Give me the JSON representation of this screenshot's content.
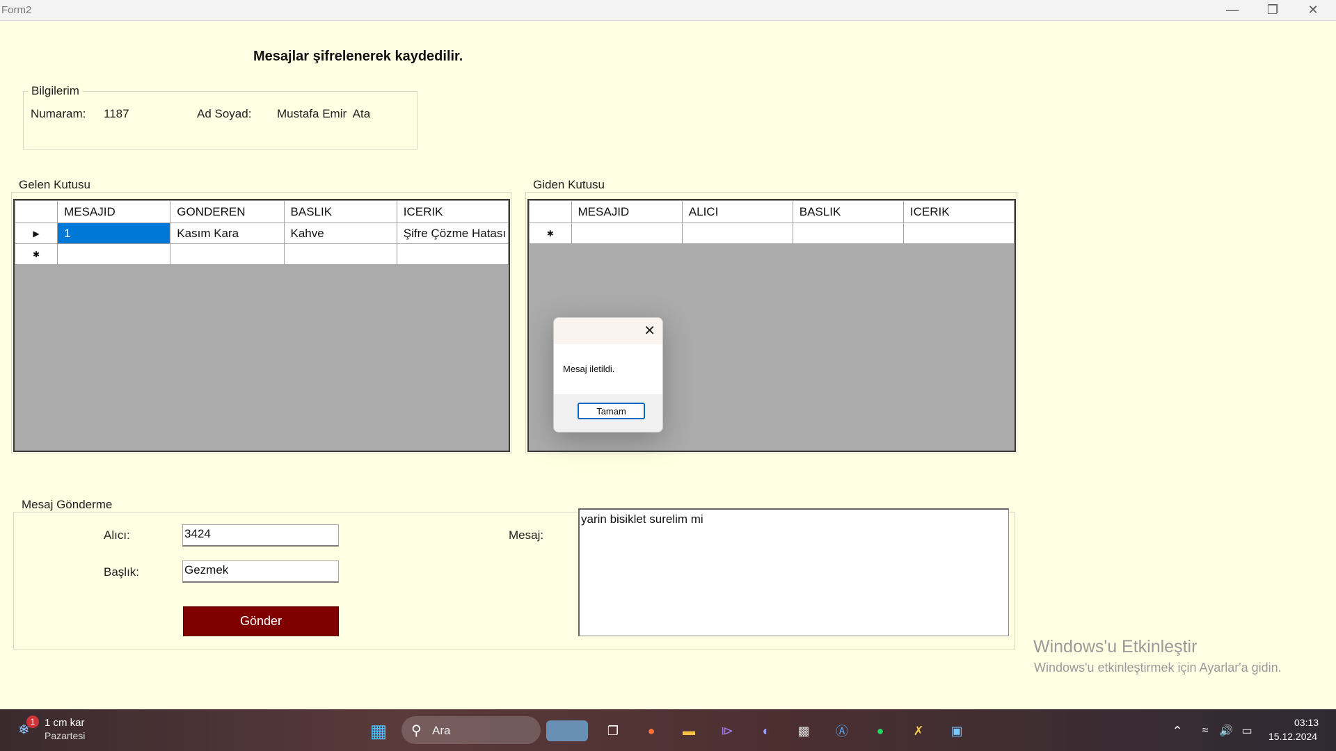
{
  "window": {
    "title": "Form2"
  },
  "header": {
    "text": "Mesajlar şifrelenerek kaydedilir."
  },
  "info": {
    "group_title": "Bilgilerim",
    "number_label": "Numaram:",
    "number_value": "1187",
    "name_label": "Ad Soyad:",
    "name_value": "Mustafa Emir  Ata"
  },
  "inbox": {
    "group_title": "Gelen Kutusu",
    "columns": [
      "MESAJID",
      "GONDEREN",
      "BASLIK",
      "ICERIK"
    ],
    "rows": [
      [
        "1",
        "Kasım Kara",
        "Kahve",
        "Şifre Çözme Hatası"
      ]
    ]
  },
  "outbox": {
    "group_title": "Giden Kutusu",
    "columns": [
      "MESAJID",
      "ALICI",
      "BASLIK",
      "ICERIK"
    ]
  },
  "send": {
    "group_title": "Mesaj Gönderme",
    "recipient_label": "Alıcı:",
    "recipient_value": "3424",
    "subject_label": "Başlık:",
    "subject_value": "Gezmek",
    "message_label": "Mesaj:",
    "message_value": "yarin bisiklet surelim mi",
    "send_button": "Gönder"
  },
  "dialog": {
    "message": "Mesaj iletildi.",
    "ok_button": "Tamam"
  },
  "watermark": {
    "line1": "Windows'u Etkinleştir",
    "line2": "Windows'u etkinleştirmek için Ayarlar'a gidin."
  },
  "taskbar": {
    "weather_badge": "1",
    "weather_text": "1 cm kar",
    "weather_day": "Pazartesi",
    "search_placeholder": "Ara",
    "time": "03:13",
    "date": "15.12.2024"
  },
  "colors": {
    "form_bg": "#ffffe4",
    "send_button_bg": "#800000",
    "selection": "#0078d7"
  }
}
